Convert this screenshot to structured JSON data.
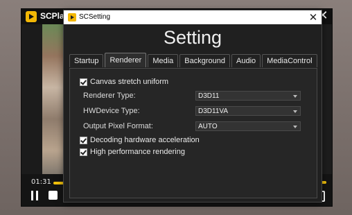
{
  "player": {
    "title": "SCPlayer",
    "time": "01:31"
  },
  "dialog": {
    "title": "SCSetting",
    "heading": "Setting",
    "tabs": [
      {
        "label": "Startup"
      },
      {
        "label": "Renderer",
        "active": true
      },
      {
        "label": "Media"
      },
      {
        "label": "Background"
      },
      {
        "label": "Audio"
      },
      {
        "label": "MediaControl"
      }
    ]
  },
  "renderer": {
    "canvas_stretch": {
      "label": "Canvas stretch uniform",
      "checked": true
    },
    "renderer_type": {
      "label": "Renderer Type:",
      "value": "D3D11"
    },
    "hwdevice_type": {
      "label": "HWDevice Type:",
      "value": "D3D11VA"
    },
    "output_pixel_format": {
      "label": "Output Pixel Format:",
      "value": "AUTO"
    },
    "decoding_hw": {
      "label": "Decoding hardware acceleration",
      "checked": true
    },
    "high_perf": {
      "label": "High performance rendering",
      "checked": true
    }
  },
  "icons": {
    "player_close": "close-icon",
    "dialog_close": "close-icon",
    "pause": "pause-icon",
    "stop": "stop-icon"
  },
  "colors": {
    "accent": "#f2b705",
    "progress": "#f2c10b"
  }
}
